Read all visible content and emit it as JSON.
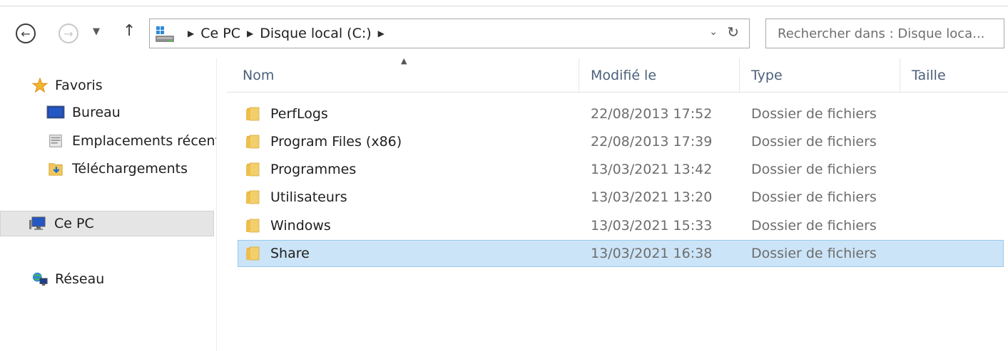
{
  "colors": {
    "selection_bg": "#cce4f7",
    "selection_border": "#99c9ef",
    "header_text": "#4c607a",
    "folder": "#f1c75b"
  },
  "nav": {
    "back_icon": "back-arrow-icon",
    "forward_icon": "forward-arrow-icon",
    "up_icon": "up-arrow-icon"
  },
  "address": {
    "crumbs": [
      "Ce PC",
      "Disque local (C:)"
    ]
  },
  "search": {
    "placeholder": "Rechercher dans : Disque loca..."
  },
  "navpane": {
    "favorites": "Favoris",
    "desktop": "Bureau",
    "recent": "Emplacements récents",
    "downloads": "Téléchargements",
    "thispc": "Ce PC",
    "network": "Réseau"
  },
  "columns": {
    "name": "Nom",
    "modified": "Modifié le",
    "type": "Type",
    "size": "Taille"
  },
  "files": [
    {
      "name": "PerfLogs",
      "modified": "22/08/2013 17:52",
      "type": "Dossier de fichiers",
      "size": ""
    },
    {
      "name": "Program Files (x86)",
      "modified": "22/08/2013 17:39",
      "type": "Dossier de fichiers",
      "size": ""
    },
    {
      "name": "Programmes",
      "modified": "13/03/2021 13:42",
      "type": "Dossier de fichiers",
      "size": ""
    },
    {
      "name": "Utilisateurs",
      "modified": "13/03/2021 13:20",
      "type": "Dossier de fichiers",
      "size": ""
    },
    {
      "name": "Windows",
      "modified": "13/03/2021 15:33",
      "type": "Dossier de fichiers",
      "size": ""
    },
    {
      "name": "Share",
      "modified": "13/03/2021 16:38",
      "type": "Dossier de fichiers",
      "size": "",
      "selected": true
    }
  ]
}
